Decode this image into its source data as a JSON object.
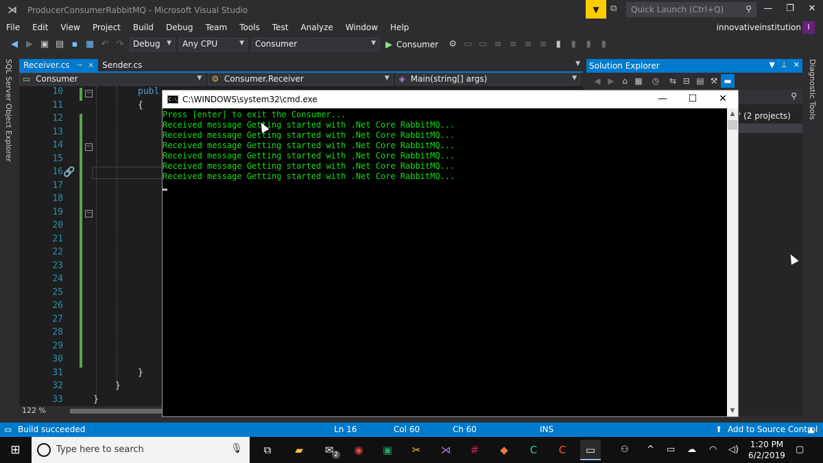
{
  "window": {
    "title": "ProducerConsumerRabbitMQ - Microsoft Visual Studio",
    "quick_launch_placeholder": "Quick Launch (Ctrl+Q)",
    "account": "innovativeinstitution",
    "avatar_letter": "I"
  },
  "menu": [
    "File",
    "Edit",
    "View",
    "Project",
    "Build",
    "Debug",
    "Team",
    "Tools",
    "Test",
    "Analyze",
    "Window",
    "Help"
  ],
  "toolbar": {
    "config": "Debug",
    "platform": "Any CPU",
    "startup_project": "Consumer",
    "run_label": "Consumer"
  },
  "left_strip": "SQL Server Object Explorer",
  "right_strip": "Diagnostic Tools",
  "doc_tabs": [
    {
      "label": "Receiver.cs",
      "active": true
    },
    {
      "label": "Sender.cs",
      "active": false
    }
  ],
  "nav": {
    "project": "Consumer",
    "type": "Consumer.Receiver",
    "member": "Main(string[] args)"
  },
  "editor": {
    "lines": [
      {
        "n": "10",
        "code": "publ",
        "kw": true
      },
      {
        "n": "11",
        "code": "{"
      },
      {
        "n": "12",
        "code": ""
      },
      {
        "n": "13",
        "code": ""
      },
      {
        "n": "14",
        "code": ""
      },
      {
        "n": "15",
        "code": ""
      },
      {
        "n": "16",
        "code": ""
      },
      {
        "n": "17",
        "code": ""
      },
      {
        "n": "18",
        "code": ""
      },
      {
        "n": "19",
        "code": ""
      },
      {
        "n": "20",
        "code": ""
      },
      {
        "n": "21",
        "code": ""
      },
      {
        "n": "22",
        "code": ""
      },
      {
        "n": "23",
        "code": ""
      },
      {
        "n": "24",
        "code": ""
      },
      {
        "n": "25",
        "code": ""
      },
      {
        "n": "26",
        "code": ""
      },
      {
        "n": "27",
        "code": ""
      },
      {
        "n": "28",
        "code": ""
      },
      {
        "n": "29",
        "code": ""
      },
      {
        "n": "30",
        "code": ""
      },
      {
        "n": "31",
        "code": "}"
      },
      {
        "n": "32",
        "code": "}"
      },
      {
        "n": "33",
        "code": "}"
      }
    ],
    "zoom": "122 %"
  },
  "solution_explorer": {
    "title": "Solution Explorer",
    "item": "' (2 projects)"
  },
  "cmd": {
    "title": "C:\\WINDOWS\\system32\\cmd.exe",
    "lines": [
      "Press [enter] to exit the Consumer...",
      "Received message Getting started with .Net Core RabbitMQ...",
      "Received message Getting started with .Net Core RabbitMQ...",
      "Received message Getting started with .Net Core RabbitMQ...",
      "Received message Getting started with .Net Core RabbitMQ...",
      "Received message Getting started with .Net Core RabbitMQ...",
      "Received message Getting started with .Net Core RabbitMQ..."
    ]
  },
  "status": {
    "message": "Build succeeded",
    "ln": "Ln 16",
    "col": "Col 60",
    "ch": "Ch 60",
    "mode": "INS",
    "source_control": "Add to Source Control"
  },
  "taskbar": {
    "search_placeholder": "Type here to search",
    "mail_badge": "2",
    "time": "1:20 PM",
    "date": "6/2/2019"
  },
  "colors": {
    "accent": "#007acc",
    "console_text": "#13e013",
    "notification": "#ffcc00"
  }
}
